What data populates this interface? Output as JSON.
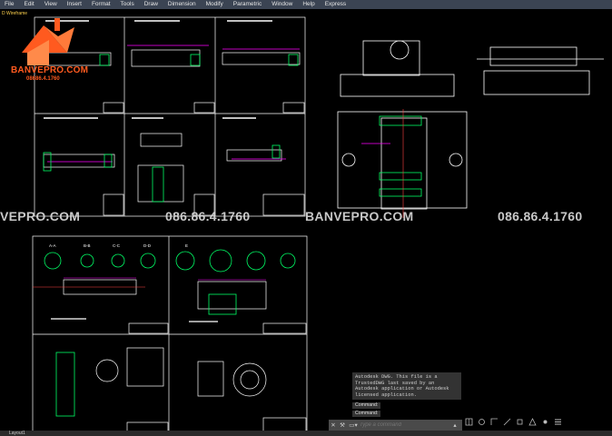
{
  "menu": [
    "File",
    "Edit",
    "View",
    "Insert",
    "Format",
    "Tools",
    "Draw",
    "Dimension",
    "Modify",
    "Parametric",
    "Window",
    "Help",
    "Express"
  ],
  "view_label": "D Wireframe",
  "brand": {
    "name": "BANVEPRO.COM",
    "phone": "08686.4.1760"
  },
  "watermarks": [
    "VEPRO.COM",
    "086.86.4.1760",
    "BANVEPRO.COM",
    "086.86.4.1760"
  ],
  "command_history": [
    "Autodesk DWG.  This file is a",
    "TrustedDWG last saved by an",
    "Autodesk application or Autodesk",
    "licensed application."
  ],
  "command_lines": [
    "Command:",
    "Command:"
  ],
  "command_input": {
    "placeholder": "Type a command"
  },
  "layout_tab": "Layout1",
  "section_labels": [
    "A-A",
    "B-B",
    "C-C",
    "D-D",
    "E"
  ],
  "colors": {
    "menubar": "#3b4453",
    "accent": "#ff5a1f",
    "frame": "#ffffff",
    "part": "#00ff66",
    "dim": "#ff00ff",
    "axis": "#ff4040"
  }
}
